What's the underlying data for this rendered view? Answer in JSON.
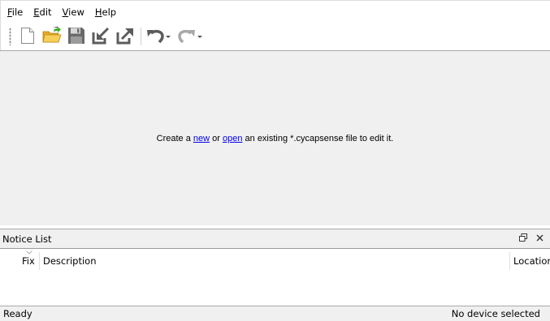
{
  "menubar": {
    "items": [
      {
        "label_mnemonic": "F",
        "label_rest": "ile"
      },
      {
        "label_mnemonic": "E",
        "label_rest": "dit"
      },
      {
        "label_mnemonic": "V",
        "label_rest": "iew"
      },
      {
        "label_mnemonic": "H",
        "label_rest": "elp"
      }
    ]
  },
  "toolbar": {
    "icons": [
      "new-file-icon",
      "open-folder-icon",
      "save-icon",
      "import-icon",
      "export-icon",
      "undo-icon",
      "redo-icon"
    ]
  },
  "editor": {
    "msg_prefix": "Create a ",
    "link_new": "new",
    "msg_middle": " or ",
    "link_open": "open",
    "msg_suffix": " an existing *.cycapsense file to edit it."
  },
  "notice_list": {
    "title": "Notice List",
    "columns": [
      "Fix",
      "Description",
      "Location"
    ]
  },
  "statusbar": {
    "left": "Ready",
    "right": "No device selected"
  },
  "colors": {
    "panel_bg": "#f0f0f0",
    "link": "#0000ee",
    "folder_yellow": "#f3c34a",
    "arrow_green": "#3fae2a",
    "icon_gray": "#5c5c5c"
  }
}
